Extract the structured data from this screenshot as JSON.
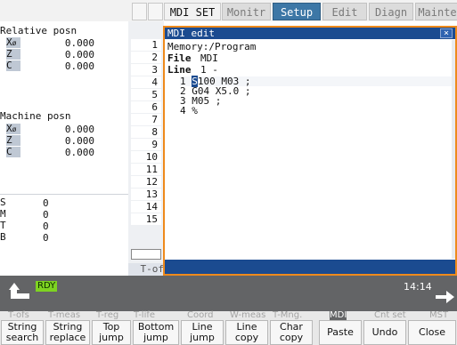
{
  "top_tabs": [
    "MDI SET",
    "Monitr",
    "Setup",
    "Edit",
    "Diagn",
    "Mainte"
  ],
  "left": {
    "relative_title": "Relative posn",
    "machine_title": "Machine posn",
    "diameter_symbol": "ø",
    "relative_axes": [
      {
        "axis": "X",
        "value": "0.000"
      },
      {
        "axis": "Z",
        "value": "0.000"
      },
      {
        "axis": "C",
        "value": "0.000"
      }
    ],
    "machine_axes": [
      {
        "axis": "X",
        "value": "0.000"
      },
      {
        "axis": "Z",
        "value": "0.000"
      },
      {
        "axis": "C",
        "value": "0.000"
      }
    ],
    "modals": [
      {
        "code": "S",
        "value": "0"
      },
      {
        "code": "M",
        "value": "0"
      },
      {
        "code": "T",
        "value": "0"
      },
      {
        "code": "B",
        "value": "0"
      }
    ]
  },
  "line_numbers": [
    "1",
    "2",
    "3",
    "4",
    "5",
    "6",
    "7",
    "8",
    "9",
    "10",
    "11",
    "12",
    "13",
    "14",
    "15"
  ],
  "lower_tab": "T-of",
  "dialog": {
    "title": "MDI edit",
    "close": "×",
    "memory": "Memory:/Program",
    "file_label": "File",
    "file_value": "MDI",
    "line_label": "Line",
    "line_value": "1 -",
    "program_lines": [
      {
        "num": "1",
        "cursor": "S",
        "text": "100 M03 ;"
      },
      {
        "num": "2",
        "cursor": "",
        "text": "G04 X5.0 ;"
      },
      {
        "num": "3",
        "cursor": "",
        "text": "M05 ;"
      },
      {
        "num": "4",
        "cursor": "",
        "text": "%"
      }
    ]
  },
  "status": {
    "rdy": "RDY",
    "time": "14:14"
  },
  "function_keys": [
    "T-ofs",
    "T-meas",
    "T-reg",
    "T-life",
    "Coord",
    "W-meas",
    "T-Mng.",
    "MDI",
    "Cnt set",
    "MST"
  ],
  "menu_buttons": [
    {
      "line1": "String",
      "line2": "search"
    },
    {
      "line1": "String",
      "line2": "replace"
    },
    {
      "line1": "Top",
      "line2": "jump"
    },
    {
      "line1": "Bottom",
      "line2": "jump"
    },
    {
      "line1": "Line",
      "line2": "jump"
    },
    {
      "line1": "Line",
      "line2": "copy"
    },
    {
      "line1": "Char",
      "line2": "copy"
    },
    {
      "line1": "Paste",
      "line2": ""
    },
    {
      "line1": "Undo",
      "line2": ""
    },
    {
      "line1": "Close",
      "line2": ""
    }
  ],
  "colors": {
    "dialog_border": "#ee8a1c",
    "dialog_title_bg": "#1b4b90",
    "active_tab": "#3d77a6",
    "rdy_green": "#7ed321",
    "statusbar": "#636466"
  }
}
